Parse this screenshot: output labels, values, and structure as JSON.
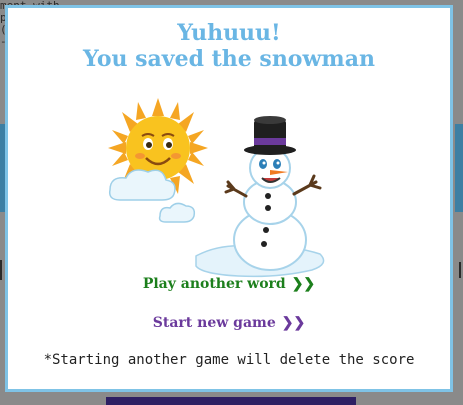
{
  "background": {
    "snippet": "ment with a small\np\n(\n-"
  },
  "modal": {
    "title_line1": "Yuhuuu!",
    "title_line2": "You saved the snowman",
    "play_another_label": "Play another word",
    "play_another_chevron": "❯❯",
    "new_game_label": "Start new game",
    "new_game_chevron": "❯❯",
    "note": "*Starting another game will delete the score"
  },
  "colors": {
    "title": "#6ab6e4",
    "border": "#7fc3e6",
    "play_link": "#1c7f1c",
    "new_game_link": "#6b3a9c"
  },
  "icons": {
    "sun": "sun-icon",
    "cloud": "cloud-icon",
    "snowman": "snowman-icon"
  }
}
